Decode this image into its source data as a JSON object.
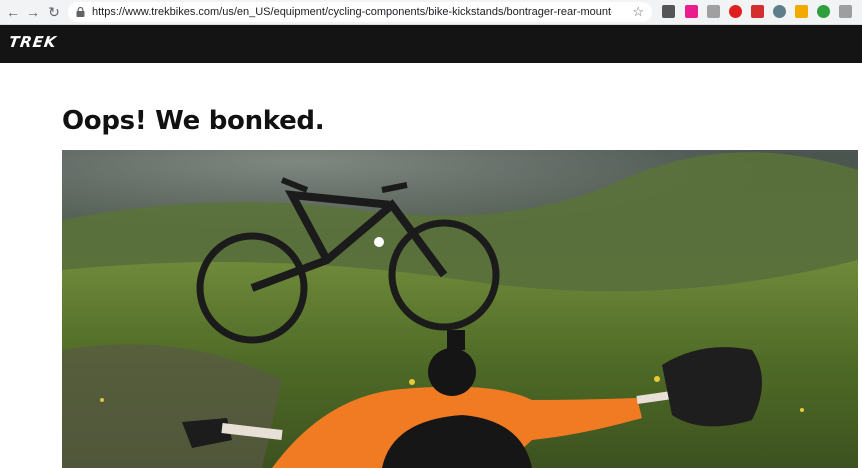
{
  "browser": {
    "url": "https://www.trekbikes.com/us/en_US/equipment/cycling-components/bike-kickstands/bontrager-rear-mount-adjustable...",
    "back_glyph": "←",
    "forward_glyph": "→",
    "reload_glyph": "↻",
    "star_glyph": "☆",
    "extension_colors": [
      "#555555",
      "#e91e8c",
      "#a0a0a0",
      "#e02020",
      "#d32f2f",
      "#607d8b",
      "#f2a900",
      "#2e9e3e",
      "#9e9e9e"
    ]
  },
  "header": {
    "logo": "TREK"
  },
  "main": {
    "title": "Oops! We bonked."
  }
}
